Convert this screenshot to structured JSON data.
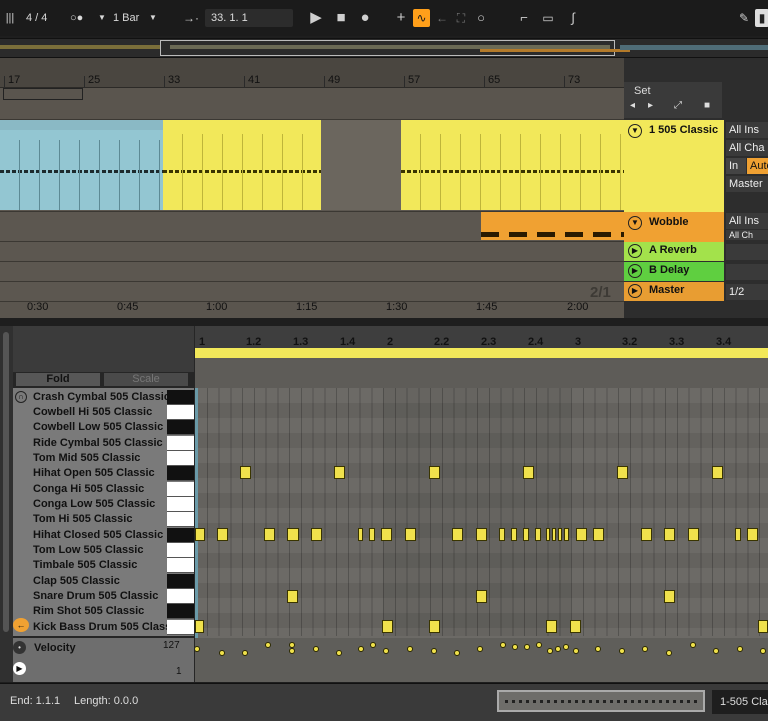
{
  "toolbar": {
    "time_signature": "4 / 4",
    "quantize": "1 Bar",
    "position": "33.  1.  1",
    "follow_icon": "follow-arrow-icon"
  },
  "arrangement": {
    "bar_markers": [
      "17",
      "25",
      "33",
      "41",
      "49",
      "57",
      "65",
      "73"
    ],
    "time_markers": [
      "0:30",
      "0:45",
      "1:00",
      "1:15",
      "1:30",
      "1:45",
      "2:00"
    ],
    "time_signature_marker": "2/1",
    "set_label": "Set"
  },
  "tracks": [
    {
      "name": "1 505 Classic",
      "color": "#f2e85a",
      "input": "All Ins",
      "channel": "All Cha",
      "monitor_in": "In",
      "monitor_auto": "Auto",
      "output": "Master"
    },
    {
      "name": "Wobble",
      "color": "#f0a132",
      "input": "All Ins",
      "channel": "All Ch"
    },
    {
      "name": "A Reverb",
      "color": "#a3e24b"
    },
    {
      "name": "B Delay",
      "color": "#5fcf40"
    },
    {
      "name": "Master",
      "color": "#e89d32",
      "output": "1/2"
    }
  ],
  "detail": {
    "fold_label": "Fold",
    "scale_label": "Scale",
    "beat_markers": [
      "1",
      "1.2",
      "1.3",
      "1.4",
      "2",
      "2.2",
      "2.3",
      "2.4",
      "3",
      "3.2",
      "3.3",
      "3.4"
    ],
    "drums": [
      "Crash Cymbal 505 Classic",
      "Cowbell Hi 505 Classic",
      "Cowbell Low 505 Classic",
      "Ride Cymbal 505 Classic",
      "Tom Mid 505 Classic",
      "Hihat Open 505 Classic",
      "Conga Hi 505 Classic",
      "Conga Low 505 Classic",
      "Tom Hi 505 Classic",
      "Hihat Closed 505 Classic",
      "Tom Low 505 Classic",
      "Timbale 505 Classic",
      "Clap 505 Classic",
      "Snare Drum 505 Classic",
      "Rim Shot 505 Classic",
      "Kick Bass Drum 505 Classic"
    ],
    "velocity_label": "Velocity",
    "velocity_max": "127",
    "velocity_min": "1"
  },
  "status": {
    "end": "End: 1.1.1",
    "length": "Length: 0.0.0",
    "device": "1-505 Cla"
  }
}
